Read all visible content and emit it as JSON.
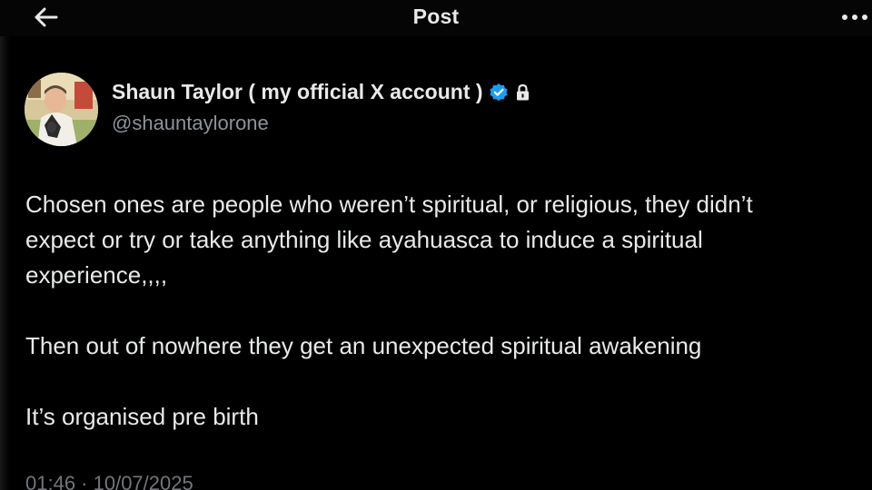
{
  "topbar": {
    "title": "Post",
    "back_icon": "arrow-left-icon",
    "more_icon": "more-horizontal-icon"
  },
  "author": {
    "name": "Shaun Taylor ( my official X account )",
    "handle": "@shauntaylorone",
    "verified_icon": "verified-badge-icon",
    "protected_icon": "lock-icon",
    "verified_color": "#1d9bf0"
  },
  "post": {
    "paragraphs": [
      "Chosen ones are people who weren’t spiritual, or religious, they didn’t\nexpect or try or take anything like ayahuasca to induce a spiritual\nexperience,,,,",
      "Then out of nowhere they get an unexpected spiritual awakening",
      "It’s organised pre birth"
    ],
    "timestamp": "01:46 · 10/07/2025"
  },
  "colors": {
    "background": "#000000",
    "text_primary": "#e7e9ea",
    "text_secondary": "#71767b"
  }
}
